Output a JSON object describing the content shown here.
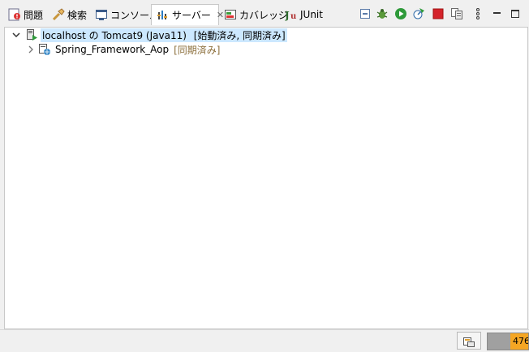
{
  "tabs": [
    {
      "label": "問題",
      "icon": "problems-icon"
    },
    {
      "label": "検索",
      "icon": "search-icon"
    },
    {
      "label": "コンソール",
      "icon": "console-icon"
    },
    {
      "label": "サーバー",
      "icon": "servers-icon",
      "active": true,
      "close": "✕"
    },
    {
      "label": "カバレッジ",
      "icon": "coverage-icon"
    },
    {
      "label": "JUnit",
      "icon": "junit-icon"
    }
  ],
  "toolbar": [
    "collapse-all-icon",
    "debug-server-icon",
    "start-server-icon",
    "profile-server-icon",
    "stop-server-icon",
    "publish-icon",
    "view-menu-icon",
    "minimize-icon",
    "maximize-icon"
  ],
  "tree": {
    "server": {
      "name": "localhost の Tomcat9 (Java11)",
      "state": "[始動済み, 同期済み]"
    },
    "module": {
      "name": "Spring_Framework_Aop",
      "state": "[同期済み]"
    }
  },
  "status": {
    "heap_text": "476"
  },
  "colors": {
    "selection": "#cce8ff",
    "decoration": "#8b6e3a",
    "heap_used": "#f5a623"
  }
}
